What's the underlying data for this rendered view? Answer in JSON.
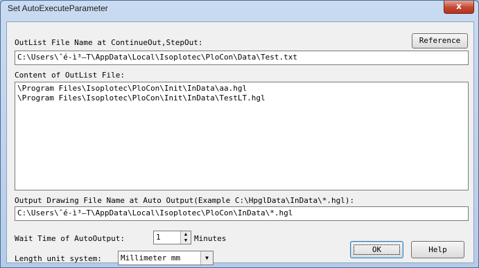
{
  "window": {
    "title": "Set AutoExecuteParameter",
    "close_glyph": "x"
  },
  "outlist": {
    "label": "OutList File Name at ContinueOut,StepOut:",
    "reference_label": "Reference",
    "path": "C:\\Users\\ˆé-ì³—T\\AppData\\Local\\Isoplotec\\PloCon\\Data\\Test.txt"
  },
  "content": {
    "label": "Content of OutList File:",
    "items": [
      "\\Program Files\\Isoplotec\\PloCon\\Init\\InData\\aa.hgl",
      "\\Program Files\\Isoplotec\\PloCon\\Init\\InData\\TestLT.hgl"
    ]
  },
  "output": {
    "label": "Output Drawing File Name at Auto Output(Example C:\\HpglData\\InData\\*.hgl):",
    "path": "C:\\Users\\ˆé-ì³—T\\AppData\\Local\\Isoplotec\\PloCon\\InData\\*.hgl"
  },
  "wait": {
    "label": "Wait Time of AutoOutput:",
    "value": "1",
    "unit": "Minutes"
  },
  "length": {
    "label": "Length unit system:",
    "selected": "Millimeter mm"
  },
  "buttons": {
    "ok": "OK",
    "help": "Help"
  },
  "icons": {
    "spin_up": "▲",
    "spin_down": "▼",
    "combo": "▼"
  }
}
